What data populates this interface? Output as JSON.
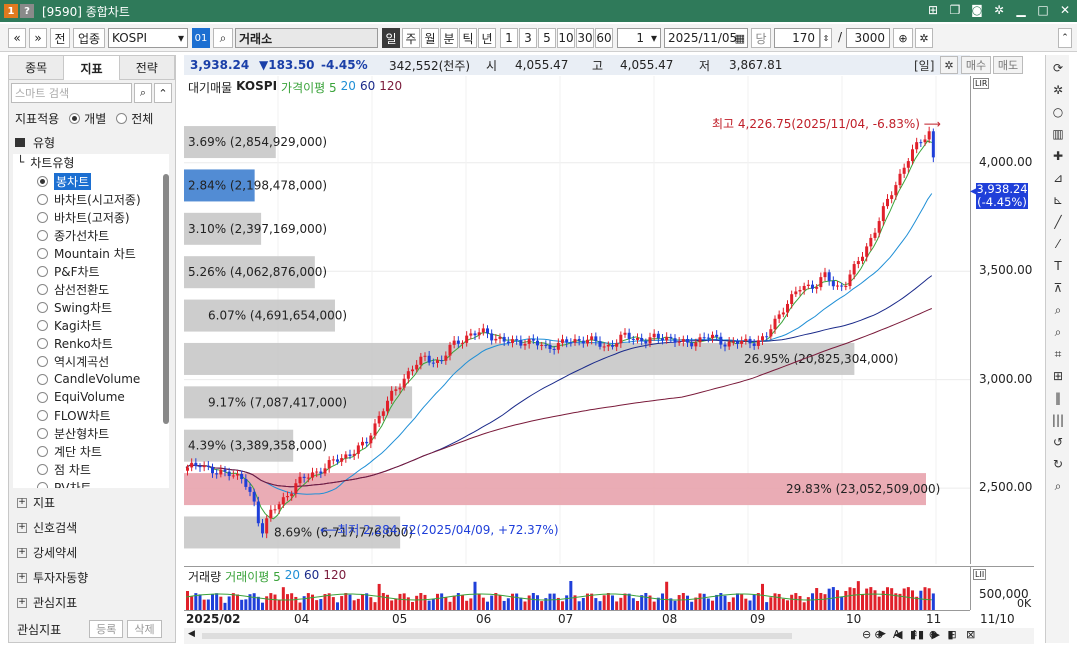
{
  "window": {
    "badge1": "1",
    "badge2": "?",
    "title": "[9590] 종합차트",
    "icons": [
      "new-window-icon",
      "copy-window-icon",
      "camera-icon",
      "settings-icon",
      "minimize-icon",
      "maximize-icon",
      "close-icon"
    ]
  },
  "toolbar": {
    "nav_prev": "«",
    "nav_down": "»",
    "btn_all": "전",
    "btn_industry": "업종",
    "symbol": "KOSPI",
    "code_badge": "01",
    "market": "거래소",
    "period_day": "일",
    "period_week": "주",
    "period_month": "월",
    "period_min": "분",
    "period_tick": "틱",
    "period_year": "년",
    "n1": "1",
    "n3": "3",
    "n5": "5",
    "n10": "10",
    "n30": "30",
    "n60": "60",
    "interval": "1",
    "date": "2025/11/05",
    "dang": "당",
    "count": "170",
    "slash": "/",
    "max_count": "3000"
  },
  "leftpanel": {
    "tabs": [
      "종목",
      "지표",
      "전략"
    ],
    "active_tab": 1,
    "search_placeholder": "스마트 검색",
    "apply_label": "지표적용",
    "opt_individual": "개별",
    "opt_all": "전체",
    "section_type": "유형",
    "tree_root": "차트유형",
    "items": [
      "봉차트",
      "바차트(시고저종)",
      "바차트(고저종)",
      "종가선차트",
      "Mountain 차트",
      "P&F차트",
      "삼선전환도",
      "Swing차트",
      "Kagi차트",
      "Renko차트",
      "역시계곡선",
      "CandleVolume",
      "EquiVolume",
      "FLOW차트",
      "분산형차트",
      "계단 차트",
      "점 차트",
      "PV차트"
    ],
    "sections": [
      "지표",
      "신호검색",
      "강세약세",
      "투자자동향",
      "관심지표"
    ],
    "footer_label": "관심지표",
    "footer_add": "등록",
    "footer_del": "삭제"
  },
  "quote": {
    "price": "3,938.24",
    "change": "▼183.50",
    "pct": "-4.45%",
    "volume": "342,552(천주)",
    "open_label": "시",
    "open": "4,055.47",
    "high_label": "고",
    "high": "4,055.47",
    "low_label": "저",
    "low": "3,867.81",
    "period_tag": "[일]",
    "buy": "매수",
    "sell": "매도"
  },
  "legend": {
    "l1": "대기매물",
    "l2": "KOSPI",
    "l3": "가격이평 5",
    "l4": "20",
    "l5": "60",
    "l6": "120"
  },
  "volume_legend": {
    "l1": "거래량",
    "l2": "거래이평 5",
    "l3": "20",
    "l4": "60",
    "l5": "120"
  },
  "chart_data": {
    "type": "candlestick",
    "series": [
      {
        "name": "KOSPI"
      },
      {
        "name": "가격이평 5"
      },
      {
        "name": "20"
      },
      {
        "name": "60"
      },
      {
        "name": "120"
      }
    ],
    "price_ticks": [
      "4,000.00",
      "3,500.00",
      "3,000.00",
      "2,500.00"
    ],
    "price_tick_values": [
      4000,
      3500,
      3000,
      2500
    ],
    "ylim": [
      2150,
      4400
    ],
    "volume_ticks": [
      "500,000",
      "0K"
    ],
    "date_ticks": [
      "2025/02",
      "04",
      "05",
      "06",
      "07",
      "08",
      "09",
      "10",
      "11"
    ],
    "right_date": "11/10",
    "current_price": "3,938.24",
    "current_pct": "(-4.45%)",
    "high_annotation": "최고 4,226.75(2025/11/04, -6.83%)",
    "low_annotation": "최저 2,284.72(2025/04/09, +72.37%)",
    "volume_profile": [
      {
        "price": 4100,
        "label": "3.69% (2,854,929,000)",
        "pct": 3.69
      },
      {
        "price": 3900,
        "label": "2.84% (2,198,478,000)",
        "pct": 2.84
      },
      {
        "price": 3700,
        "label": "3.10% (2,397,169,000)",
        "pct": 3.1
      },
      {
        "price": 3500,
        "label": "5.26% (4,062,876,000)",
        "pct": 5.26
      },
      {
        "price": 3300,
        "label": "6.07% (4,691,654,000)",
        "pct": 6.07
      },
      {
        "price": 3100,
        "label": "26.95% (20,825,304,000)",
        "pct": 26.95
      },
      {
        "price": 2900,
        "label": "9.17% (7,087,417,000)",
        "pct": 9.17
      },
      {
        "price": 2700,
        "label": "4.39% (3,389,358,000)",
        "pct": 4.39
      },
      {
        "price": 2500,
        "label": "29.83% (23,052,509,000)",
        "pct": 29.83
      },
      {
        "price": 2300,
        "label": "8.69% (6,717,776,000)",
        "pct": 8.69
      }
    ]
  },
  "right_icons": [
    "refresh-icon",
    "gear-icon",
    "circle-icon",
    "chart-icon",
    "crosshair-icon",
    "line-icon",
    "line2-icon",
    "trend-line-icon",
    "auto-line-icon",
    "text-icon",
    "fib-icon",
    "zoom-icon",
    "zoom2-icon",
    "grid-icon",
    "measure-icon",
    "bars-icon",
    "bars2-icon",
    "undo-icon",
    "redo-icon",
    "search-icon"
  ]
}
